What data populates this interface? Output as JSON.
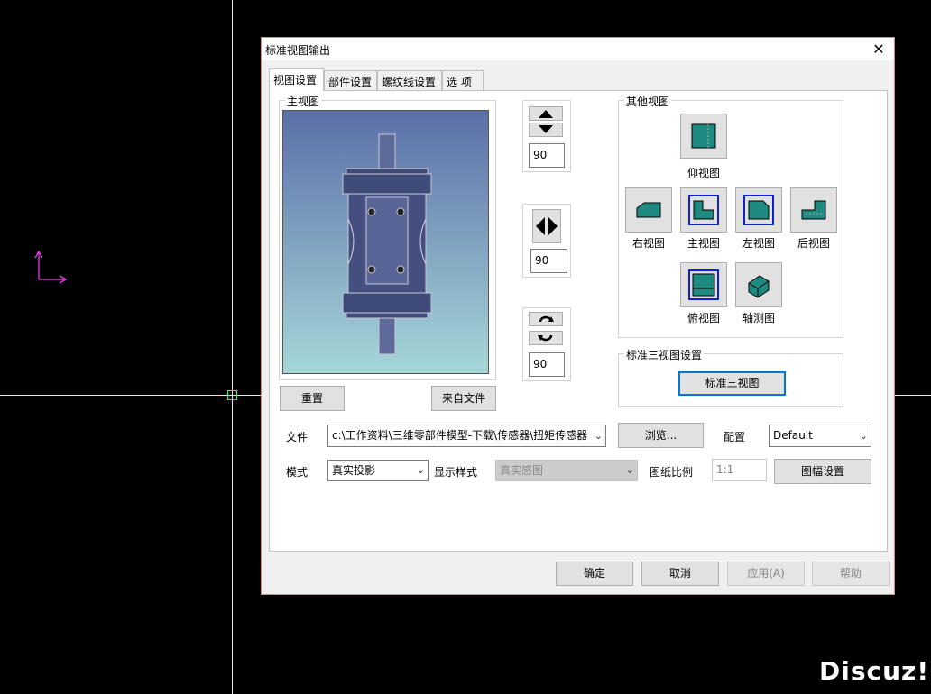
{
  "dialog": {
    "title": "标准视图输出",
    "tabs": [
      {
        "label": "视图设置",
        "active": true
      },
      {
        "label": "部件设置",
        "active": false
      },
      {
        "label": "螺纹线设置",
        "active": false
      },
      {
        "label": "选 项",
        "active": false
      }
    ],
    "main_view": {
      "label": "主视图",
      "reset_label": "重置",
      "from_file_label": "来自文件"
    },
    "rotation": {
      "vertical_value": "90",
      "horizontal_value": "90",
      "spin_value": "90"
    },
    "other_views": {
      "label": "其他视图",
      "bottom_view": "仰视图",
      "right_view": "右视图",
      "front_view": "主视图",
      "left_view": "左视图",
      "back_view": "后视图",
      "top_view": "俯视图",
      "iso_view": "轴测图"
    },
    "standard_three": {
      "label": "标准三视图设置",
      "button_label": "标准三视图"
    },
    "file": {
      "label": "文件",
      "value": "c:\\工作资料\\三维零部件模型-下载\\传感器\\扭矩传感器",
      "browse_label": "浏览...",
      "config_label": "配置",
      "config_value": "Default"
    },
    "mode": {
      "label": "模式",
      "value": "真实投影",
      "display_style_label": "显示样式",
      "display_style_value": "真实感图",
      "scale_label": "图纸比例",
      "scale_value": "1:1",
      "sheet_setup_label": "图幅设置"
    },
    "footer": {
      "ok": "确定",
      "cancel": "取消",
      "apply": "应用(A)",
      "help": "帮助"
    }
  },
  "watermark": "Discuz!",
  "colors": {
    "accent": "#0078d7",
    "view_face": "#1e8a80",
    "ucs_icon": "#e040e0"
  }
}
